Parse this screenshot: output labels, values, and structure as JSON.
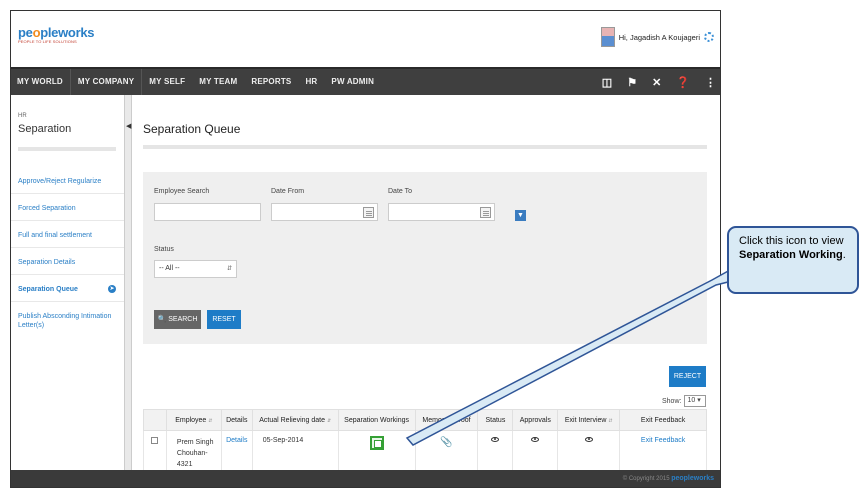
{
  "header": {
    "logo_text_a": "pe",
    "logo_text_o": "o",
    "logo_text_b": "pleworks",
    "logo_tagline": "PEOPLE TO LIFE SOLUTIONS",
    "greeting": "Hi, Jagadish A Koujageri"
  },
  "nav": {
    "items": [
      "MY WORLD",
      "MY COMPANY",
      "MY SELF",
      "MY TEAM",
      "REPORTS",
      "HR",
      "PW ADMIN"
    ],
    "icons": [
      "book-icon",
      "flag-icon",
      "tools-icon",
      "help-icon",
      "share-icon"
    ]
  },
  "sidebar": {
    "section": "HR",
    "title": "Separation",
    "items": [
      {
        "label": "Approve/Reject Regularize",
        "active": false
      },
      {
        "label": "Forced Separation",
        "active": false
      },
      {
        "label": "Full and final settlement",
        "active": false
      },
      {
        "label": "Separation Details",
        "active": false
      },
      {
        "label": "Separation Queue",
        "active": true
      },
      {
        "label": "Publish Absconding Intimation Letter(s)",
        "active": false
      }
    ]
  },
  "main": {
    "title": "Separation Queue",
    "filters": {
      "employee_search_label": "Employee Search",
      "date_from_label": "Date From",
      "date_to_label": "Date To",
      "status_label": "Status",
      "status_value": "-- All --"
    },
    "search_label": "SEARCH",
    "reset_label": "RESET",
    "reject_label": "REJECT",
    "show_label": "Show:",
    "show_value": "10"
  },
  "table": {
    "headers": [
      "",
      "Employee",
      "Details",
      "Actual Relieving date",
      "Separation Workings",
      "Memos & Proof",
      "Status",
      "Approvals",
      "Exit Interview",
      "Exit Feedback"
    ],
    "rows": [
      {
        "employee": "Prem Singh Chouhan-4321",
        "details": "Details",
        "relieving_date": "05-Sep-2014",
        "exit_feedback": "Exit Feedback"
      }
    ]
  },
  "footer": {
    "copyright": "© Copyright 2015",
    "brand": "peopleworks"
  },
  "callout": {
    "text_before": "Click this icon to view ",
    "text_bold": "Separation Working",
    "text_after": "."
  }
}
